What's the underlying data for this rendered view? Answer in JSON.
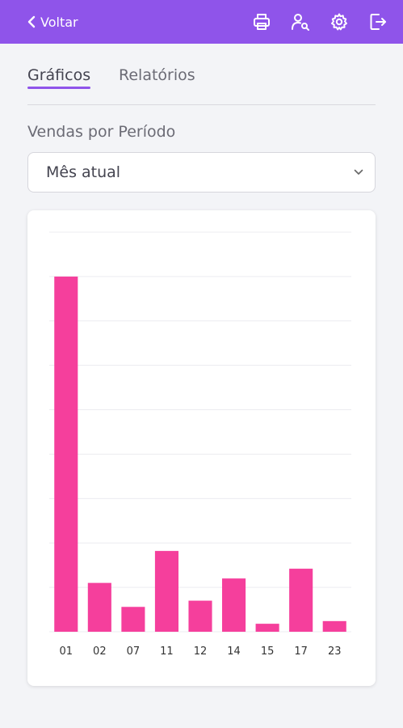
{
  "topbar": {
    "back_label": "Voltar",
    "background": "#8f54ea",
    "actions": [
      "print-icon",
      "user-search-icon",
      "gear-icon",
      "logout-icon"
    ]
  },
  "tabs": [
    {
      "label": "Gráficos",
      "active": true
    },
    {
      "label": "Relatórios",
      "active": false
    }
  ],
  "filter": {
    "label": "Vendas por Período",
    "selected": "Mês atual"
  },
  "chart_data": {
    "type": "bar",
    "categories": [
      "01",
      "02",
      "07",
      "11",
      "12",
      "14",
      "15",
      "17",
      "23"
    ],
    "values": [
      40,
      5.5,
      2.8,
      9.1,
      3.5,
      6.0,
      0.9,
      7.1,
      1.2
    ],
    "ylim": [
      0,
      45
    ],
    "yticks": [
      0,
      5,
      10,
      15,
      20,
      25,
      30,
      35,
      40,
      45
    ],
    "grid": true,
    "bar_color": "#f53f9c",
    "title": "",
    "xlabel": "",
    "ylabel": ""
  }
}
